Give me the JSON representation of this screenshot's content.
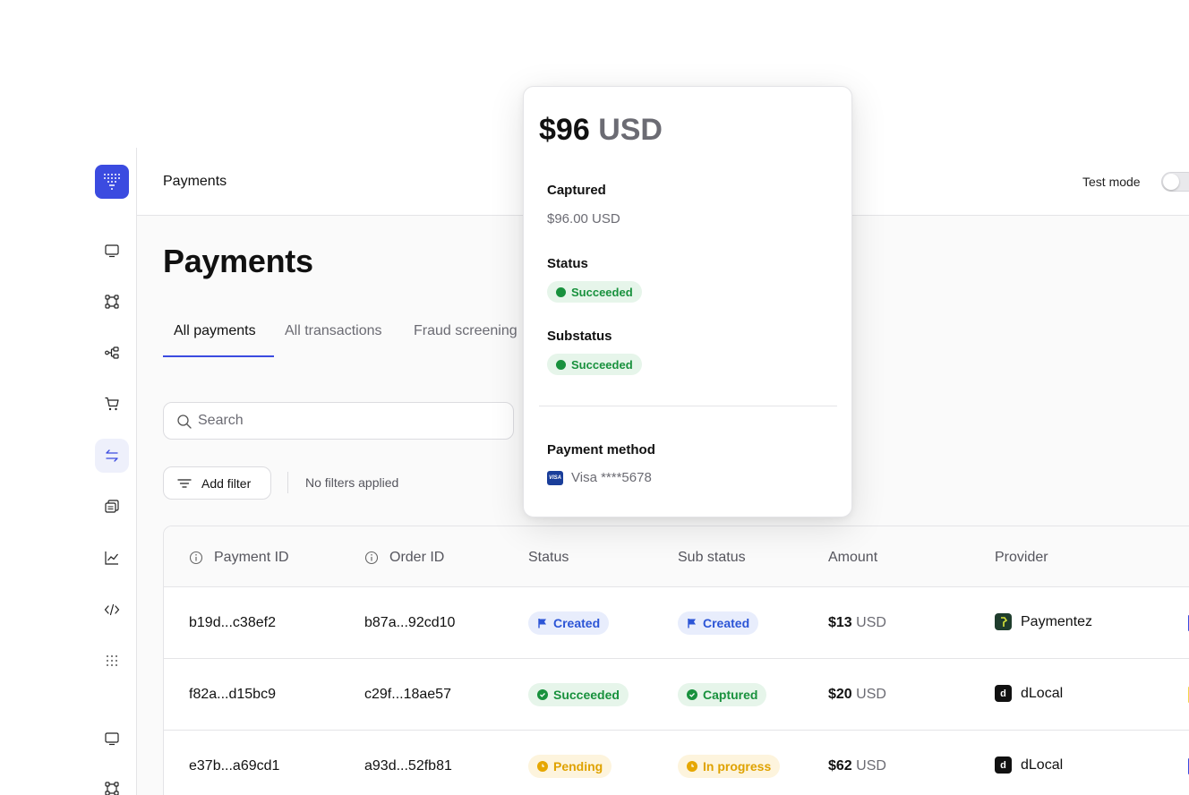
{
  "header": {
    "title": "Payments",
    "test_mode_label": "Test mode",
    "test_mode_on": false
  },
  "page_title": "Payments",
  "tabs": [
    {
      "label": "All payments",
      "active": true
    },
    {
      "label": "All transactions",
      "active": false
    },
    {
      "label": "Fraud screening",
      "active": false
    }
  ],
  "search": {
    "placeholder": "Search",
    "value": ""
  },
  "filters": {
    "add_label": "Add filter",
    "status_text": "No filters applied"
  },
  "table": {
    "columns": [
      "Payment ID",
      "Order ID",
      "Status",
      "Sub status",
      "Amount",
      "Provider"
    ],
    "rows": [
      {
        "payment_id": "b19d...c38ef2",
        "order_id": "b87a...92cd10",
        "status": "Created",
        "sub_status": "Created",
        "amount": "$13",
        "currency": "USD",
        "provider": "Paymentez"
      },
      {
        "payment_id": "f82a...d15bc9",
        "order_id": "c29f...18ae57",
        "status": "Succeeded",
        "sub_status": "Captured",
        "amount": "$20",
        "currency": "USD",
        "provider": "dLocal"
      },
      {
        "payment_id": "e37b...a69cd1",
        "order_id": "a93d...52fb81",
        "status": "Pending",
        "sub_status": "In progress",
        "amount": "$62",
        "currency": "USD",
        "provider": "dLocal"
      }
    ]
  },
  "popover": {
    "amount": "$96",
    "currency": "USD",
    "captured_label": "Captured",
    "captured_value": "$96.00 USD",
    "status_label": "Status",
    "status_value": "Succeeded",
    "substatus_label": "Substatus",
    "substatus_value": "Succeeded",
    "payment_method_label": "Payment method",
    "payment_method_value": "Visa ****5678",
    "card_brand_text": "VISA"
  },
  "providers": {
    "paymentez_mark": "",
    "dlocal_mark": "d"
  },
  "colors": {
    "accent": "#3b4be0",
    "success": "#18913d",
    "pending": "#e6a700",
    "created": "#2c55d6"
  },
  "sidebar": {
    "icons": [
      "logo",
      "monitor-icon",
      "flow-icon",
      "workflow-icon",
      "cart-icon",
      "transactions-icon",
      "reconcile-icon",
      "chart-icon",
      "code-icon",
      "grid-icon",
      "monitor-icon",
      "flow-icon"
    ],
    "active": "transactions-icon"
  }
}
